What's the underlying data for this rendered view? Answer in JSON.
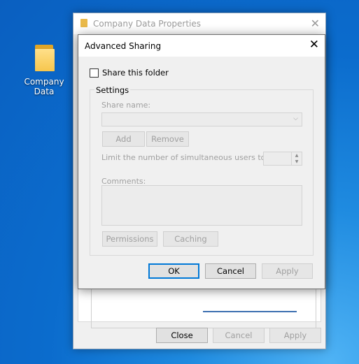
{
  "desktop": {
    "icon_label_line1": "Company",
    "icon_label_line2": "Data",
    "icon": "folder-icon"
  },
  "properties_window": {
    "title": "Company Data Properties",
    "close_glyph": "✕",
    "buttons": {
      "close": "Close",
      "cancel": "Cancel",
      "apply": "Apply"
    }
  },
  "advanced_sharing": {
    "title": "Advanced Sharing",
    "close_glyph": "✕",
    "share_checkbox_label": "Share this folder",
    "share_checked": false,
    "settings_legend": "Settings",
    "share_name_label": "Share name:",
    "share_name_value": "",
    "add_button": "Add",
    "remove_button": "Remove",
    "limit_label": "Limit the number of simultaneous users to:",
    "limit_value": "",
    "comments_label": "Comments:",
    "comments_value": "",
    "permissions_button": "Permissions",
    "caching_button": "Caching",
    "ok_button": "OK",
    "cancel_button": "Cancel",
    "apply_button": "Apply"
  },
  "colors": {
    "accent": "#0078d7",
    "disabled_text": "#a0a0a0",
    "dialog_bg": "#f0f0f0"
  }
}
